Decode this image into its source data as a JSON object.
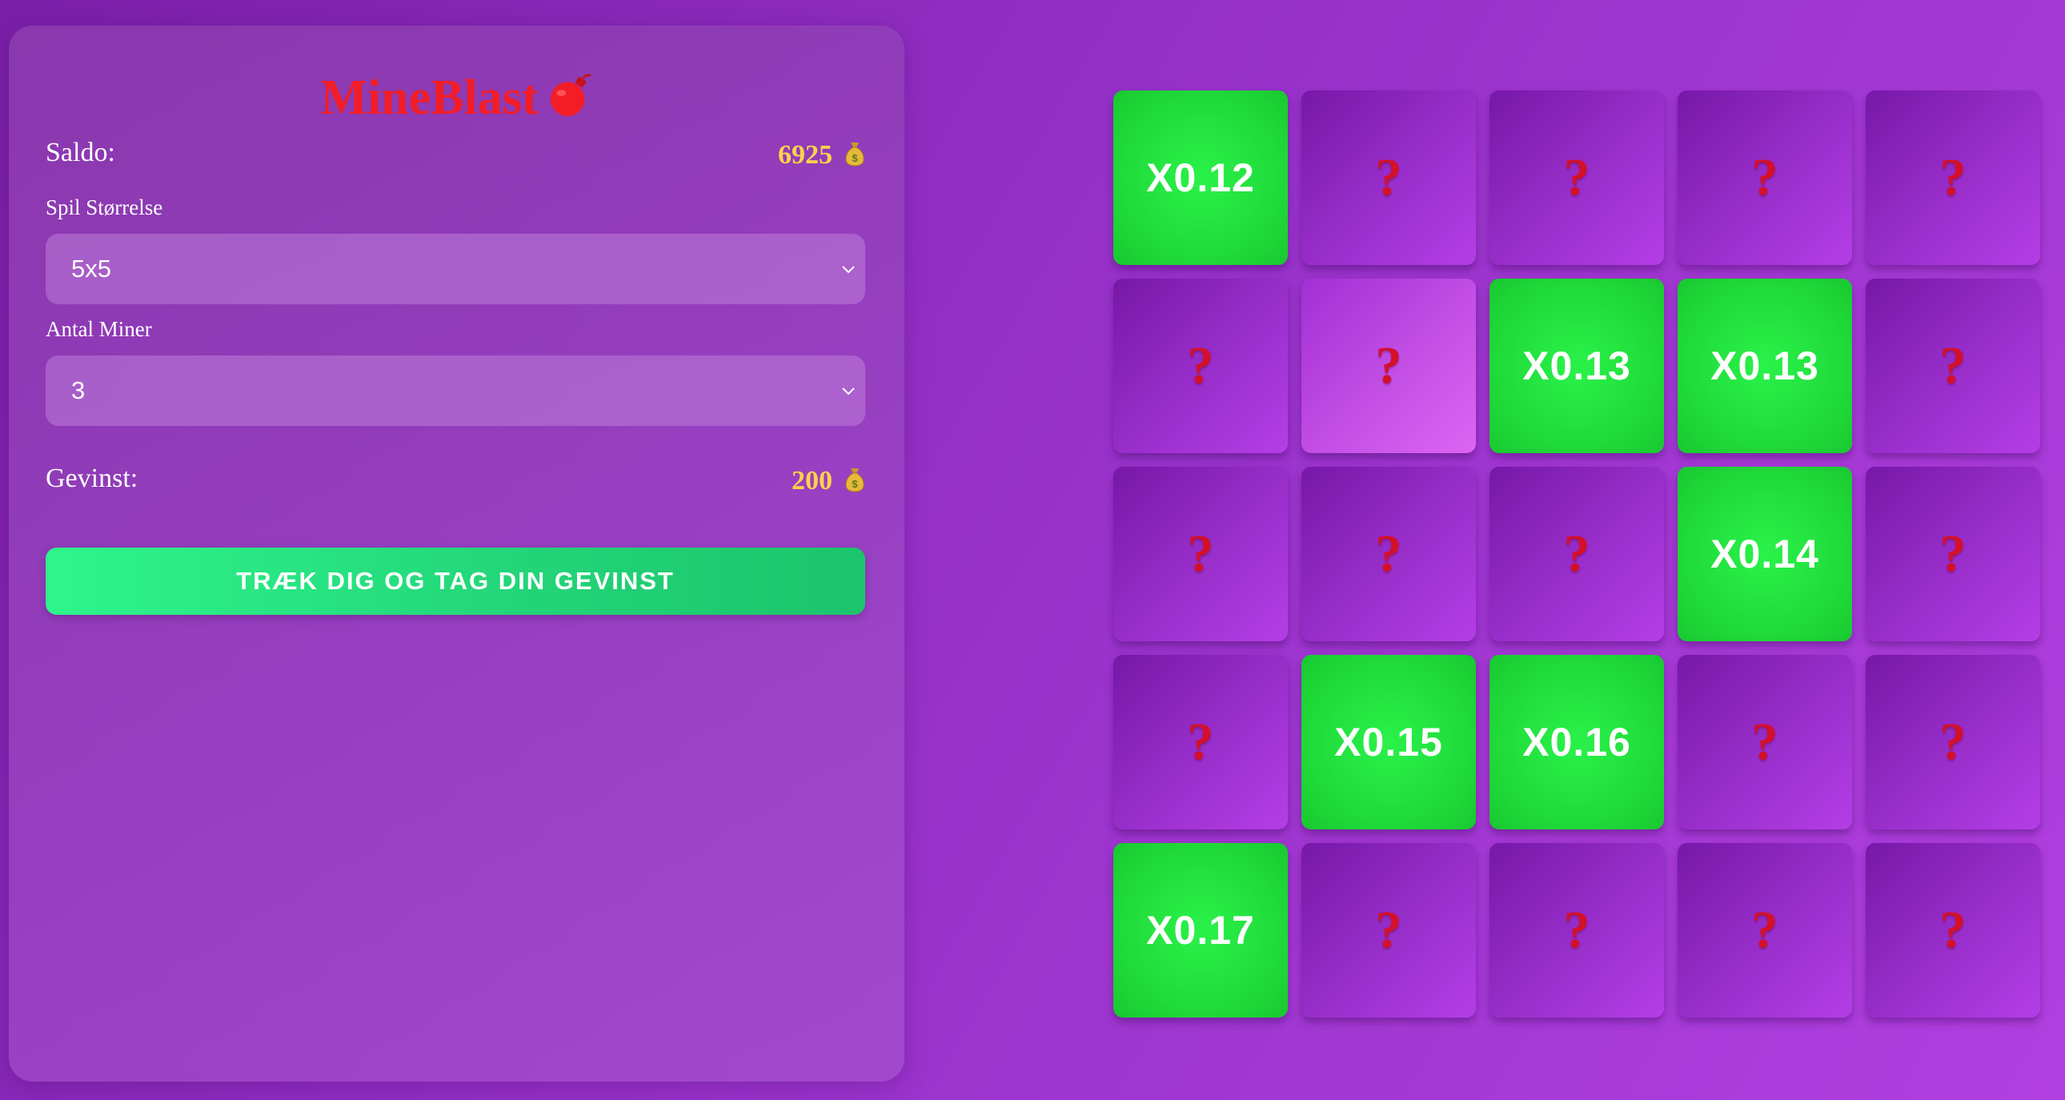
{
  "app": {
    "title": "MineBlast",
    "title_icon": "bomb-icon"
  },
  "stats": {
    "balance_label": "Saldo:",
    "balance_value": "6925",
    "winnings_label": "Gevinst:",
    "winnings_value": "200",
    "currency_icon": "money-bag-icon"
  },
  "settings": {
    "size_label": "Spil Størrelse",
    "size_value": "5x5",
    "mines_label": "Antal Miner",
    "mines_value": "3"
  },
  "cashout": {
    "label": "TRÆK DIG OG TAG DIN GEVINST"
  },
  "colors": {
    "title": "#f21d27",
    "value": "#ffd24a",
    "revealed_tile": "#1fd838",
    "hidden_tile": "#9a2fcc",
    "question_mark": "#d4102a",
    "cashout_button": "#22d478"
  },
  "board": {
    "hidden_symbol": "?",
    "rows": [
      [
        {
          "state": "revealed",
          "text": "X0.12"
        },
        {
          "state": "hidden",
          "text": "?"
        },
        {
          "state": "hidden",
          "text": "?"
        },
        {
          "state": "hidden",
          "text": "?"
        },
        {
          "state": "hidden",
          "text": "?"
        }
      ],
      [
        {
          "state": "hidden",
          "text": "?"
        },
        {
          "state": "hover",
          "text": "?"
        },
        {
          "state": "revealed",
          "text": "X0.13"
        },
        {
          "state": "revealed",
          "text": "X0.13"
        },
        {
          "state": "hidden",
          "text": "?"
        }
      ],
      [
        {
          "state": "hidden",
          "text": "?"
        },
        {
          "state": "hidden",
          "text": "?"
        },
        {
          "state": "hidden",
          "text": "?"
        },
        {
          "state": "revealed",
          "text": "X0.14"
        },
        {
          "state": "hidden",
          "text": "?"
        }
      ],
      [
        {
          "state": "hidden",
          "text": "?"
        },
        {
          "state": "revealed",
          "text": "X0.15"
        },
        {
          "state": "revealed",
          "text": "X0.16"
        },
        {
          "state": "hidden",
          "text": "?"
        },
        {
          "state": "hidden",
          "text": "?"
        }
      ],
      [
        {
          "state": "revealed",
          "text": "X0.17"
        },
        {
          "state": "hidden",
          "text": "?"
        },
        {
          "state": "hidden",
          "text": "?"
        },
        {
          "state": "hidden",
          "text": "?"
        },
        {
          "state": "hidden",
          "text": "?"
        }
      ]
    ]
  }
}
